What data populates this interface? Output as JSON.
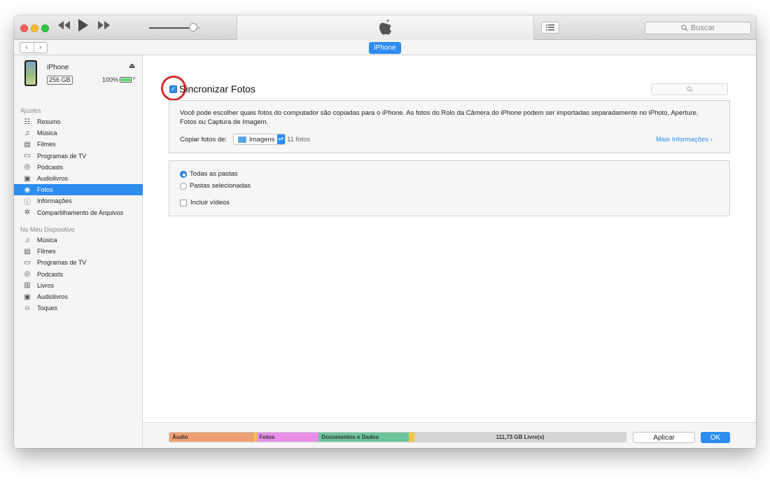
{
  "toolbar": {
    "prev_icon": "rewind-icon",
    "play_icon": "play-icon",
    "next_icon": "fast-forward-icon",
    "volume_level": 0.88,
    "search_placeholder": "Buscar"
  },
  "nav": {
    "back_icon": "chevron-left-icon",
    "forward_icon": "chevron-right-icon",
    "device_tab": "iPhone"
  },
  "device": {
    "name": "iPhone",
    "capacity": "256 GB",
    "battery": "100%",
    "battery_level": 1.0
  },
  "sidebar": {
    "settings_header": "Ajustes",
    "settings_items": [
      {
        "label": "Resumo",
        "icon": "summary-icon"
      },
      {
        "label": "Música",
        "icon": "music-icon"
      },
      {
        "label": "Filmes",
        "icon": "film-icon"
      },
      {
        "label": "Programas de TV",
        "icon": "tv-icon"
      },
      {
        "label": "Podcasts",
        "icon": "podcast-icon"
      },
      {
        "label": "Audiolivros",
        "icon": "audiobook-icon"
      },
      {
        "label": "Fotos",
        "icon": "camera-icon",
        "selected": true
      },
      {
        "label": "Informações",
        "icon": "info-icon"
      },
      {
        "label": "Compartilhamento de Arquivos",
        "icon": "file-sharing-icon"
      }
    ],
    "device_header": "No Meu Dispositivo",
    "device_items": [
      {
        "label": "Música",
        "icon": "music-icon"
      },
      {
        "label": "Filmes",
        "icon": "film-icon"
      },
      {
        "label": "Programas de TV",
        "icon": "tv-icon"
      },
      {
        "label": "Podcasts",
        "icon": "podcast-icon"
      },
      {
        "label": "Livros",
        "icon": "book-icon"
      },
      {
        "label": "Audiolivros",
        "icon": "audiobook-icon"
      },
      {
        "label": "Toques",
        "icon": "bell-icon"
      }
    ]
  },
  "main": {
    "sync_title": "Sincronizar Fotos",
    "sync_checked": true,
    "description": "Você pode escolher quais fotos do computador são copiadas para o iPhone. As fotos do Rolo da Câmera do iPhone podem ser importadas separadamente no iPhoto, Aperture, Fotos ou Captura de Imagem.",
    "copy_from_label": "Copiar fotos de:",
    "copy_from_value": "Imagens",
    "photo_count": "11 fotos",
    "more_info": "Mais Informações",
    "options": {
      "all_folders": "Todas as pastas",
      "selected_folders": "Pastas selecionadas",
      "include_videos": "Incluir vídeos",
      "selected_option": "all_folders",
      "include_videos_checked": false
    }
  },
  "storage": {
    "segments": [
      {
        "label": "Áudio",
        "fraction": 0.185,
        "color": "#f0a070"
      },
      {
        "label": "",
        "fraction": 0.006,
        "color": "#f5c842"
      },
      {
        "label": "Fotos",
        "fraction": 0.136,
        "color": "#e88ee8"
      },
      {
        "label": "Documentos e Dados",
        "fraction": 0.197,
        "color": "#6cc59a"
      },
      {
        "label": "",
        "fraction": 0.013,
        "color": "#f5c842"
      }
    ],
    "free_label": "111,73 GB Livre(s)",
    "free_color": "#d6d6d6"
  },
  "buttons": {
    "apply": "Aplicar",
    "ok": "OK"
  },
  "colors": {
    "accent": "#2d8cf0",
    "highlight_circle": "#d92b2b"
  }
}
